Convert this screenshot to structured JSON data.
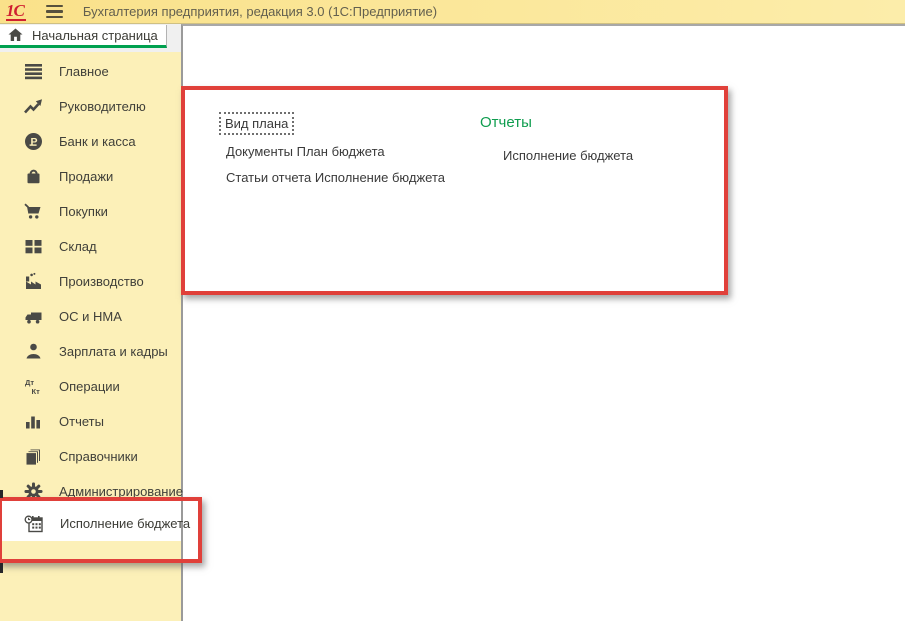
{
  "window": {
    "logo": "1С",
    "title": "Бухгалтерия предприятия, редакция 3.0  (1С:Предприятие)"
  },
  "tab": {
    "label": "Начальная страница"
  },
  "sidebar": {
    "items": [
      {
        "label": "Главное",
        "icon": "menu-lines-icon"
      },
      {
        "label": "Руководителю",
        "icon": "trend-arrow-icon"
      },
      {
        "label": "Банк и касса",
        "icon": "ruble-circle-icon"
      },
      {
        "label": "Продажи",
        "icon": "shopping-bag-icon"
      },
      {
        "label": "Покупки",
        "icon": "shopping-cart-icon"
      },
      {
        "label": "Склад",
        "icon": "warehouse-grid-icon"
      },
      {
        "label": "Производство",
        "icon": "factory-icon"
      },
      {
        "label": "ОС и НМА",
        "icon": "truck-icon"
      },
      {
        "label": "Зарплата и кадры",
        "icon": "person-icon"
      },
      {
        "label": "Операции",
        "icon": "debit-credit-icon"
      },
      {
        "label": "Отчеты",
        "icon": "bar-chart-icon"
      },
      {
        "label": "Справочники",
        "icon": "catalogs-icon"
      },
      {
        "label": "Администрирование",
        "icon": "gear-icon"
      }
    ],
    "selected_item": {
      "label": "Исполнение бюджета",
      "icon": "budget-calendar-icon"
    }
  },
  "content": {
    "links_left": [
      "Вид плана",
      "Документы План бюджета",
      "Статьи отчета Исполнение бюджета"
    ],
    "reports_section": {
      "title": "Отчеты",
      "links": [
        "Исполнение бюджета"
      ]
    }
  },
  "annotations": {
    "highlight_color": "#e0403a"
  },
  "colors": {
    "topbar_bg": "#fbe48e",
    "sidebar_bg": "#fcf0b8",
    "accent_green": "#00a04f",
    "logo_red": "#cf2030"
  }
}
